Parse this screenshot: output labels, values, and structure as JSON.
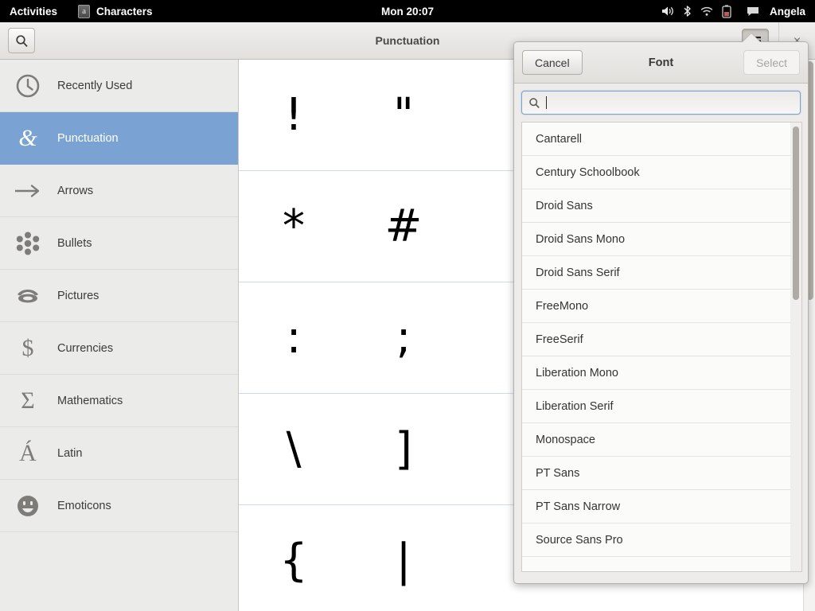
{
  "topbar": {
    "activities": "Activities",
    "app_name": "Characters",
    "app_icon": "characters-app-icon",
    "app_icon_glyph": "a",
    "clock": "Mon 20:07",
    "user": "Angela",
    "tray_icons": [
      "volume-icon",
      "bluetooth-icon",
      "wifi-icon",
      "battery-icon",
      "chat-icon"
    ]
  },
  "window": {
    "title": "Punctuation",
    "search_icon": "search-icon",
    "menu_icon": "hamburger-menu-icon",
    "close_label": "×"
  },
  "sidebar": {
    "items": [
      {
        "label": "Recently Used",
        "icon": "clock-icon",
        "selected": false
      },
      {
        "label": "Punctuation",
        "icon": "ampersand-icon",
        "glyph": "&",
        "selected": true
      },
      {
        "label": "Arrows",
        "icon": "arrow-right-icon",
        "selected": false
      },
      {
        "label": "Bullets",
        "icon": "bullet-flower-icon",
        "selected": false
      },
      {
        "label": "Pictures",
        "icon": "telephone-icon",
        "selected": false
      },
      {
        "label": "Currencies",
        "icon": "dollar-sign-icon",
        "glyph": "$",
        "selected": false
      },
      {
        "label": "Mathematics",
        "icon": "sigma-icon",
        "glyph": "Σ",
        "selected": false
      },
      {
        "label": "Latin",
        "icon": "a-acute-icon",
        "glyph": "Á",
        "selected": false
      },
      {
        "label": "Emoticons",
        "icon": "smiley-face-icon",
        "selected": false
      }
    ]
  },
  "chargrid": {
    "rows": [
      [
        "!",
        "\""
      ],
      [
        "*",
        "#"
      ],
      [
        ":",
        ";"
      ],
      [
        "\\",
        "]"
      ],
      [
        "{",
        "|"
      ]
    ]
  },
  "popover": {
    "cancel_label": "Cancel",
    "title": "Font",
    "select_label": "Select",
    "search_icon": "search-icon",
    "search_value": "",
    "search_placeholder": "",
    "fonts": [
      "Cantarell",
      "Century Schoolbook",
      "Droid Sans",
      "Droid Sans Mono",
      "Droid Sans Serif",
      "FreeMono",
      "FreeSerif",
      "Liberation Mono",
      "Liberation Serif",
      "Monospace",
      "PT Sans",
      "PT Sans Narrow",
      "Source Sans Pro"
    ]
  },
  "colors": {
    "selection_blue": "#7aa3d4",
    "topbar_black": "#000000",
    "headerbar": "#e9e7e4",
    "sidebar_bg": "#ebebe9",
    "grid_line": "#cfdced"
  }
}
